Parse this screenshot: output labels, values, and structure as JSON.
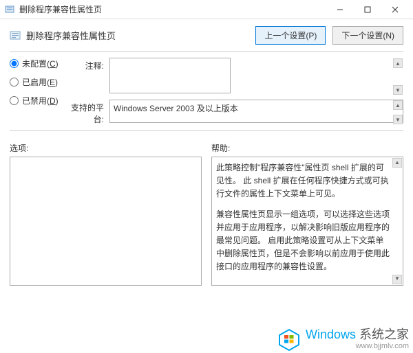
{
  "window": {
    "title": "删除程序兼容性属性页"
  },
  "header": {
    "title": "删除程序兼容性属性页",
    "prev_button": "上一个设置(P)",
    "next_button": "下一个设置(N)"
  },
  "radios": {
    "not_configured": {
      "label": "未配置(",
      "hotkey": "C",
      "suffix": ")"
    },
    "enabled": {
      "label": "已启用(",
      "hotkey": "E",
      "suffix": ")"
    },
    "disabled": {
      "label": "已禁用(",
      "hotkey": "D",
      "suffix": ")"
    }
  },
  "fields": {
    "comment_label": "注释:",
    "comment_value": "",
    "platform_label": "支持的平台:",
    "platform_value": "Windows Server 2003 及以上版本"
  },
  "bottom": {
    "options_label": "选项:",
    "help_label": "帮助:",
    "help_p1": "此策略控制\"程序兼容性\"属性页 shell 扩展的可见性。 此 shell 扩展在任何程序快捷方式或可执行文件的属性上下文菜单上可见。",
    "help_p2": "兼容性属性页显示一组选项，可以选择这些选项并应用于应用程序，以解决影响旧版应用程序的最常见问题。 启用此策略设置可从上下文菜单中删除属性页，但是不会影响以前应用于使用此接口的应用程序的兼容性设置。"
  },
  "watermark": {
    "brand": "Windows",
    "subtitle": "系统之家",
    "url": "www.bjjmlv.com"
  }
}
